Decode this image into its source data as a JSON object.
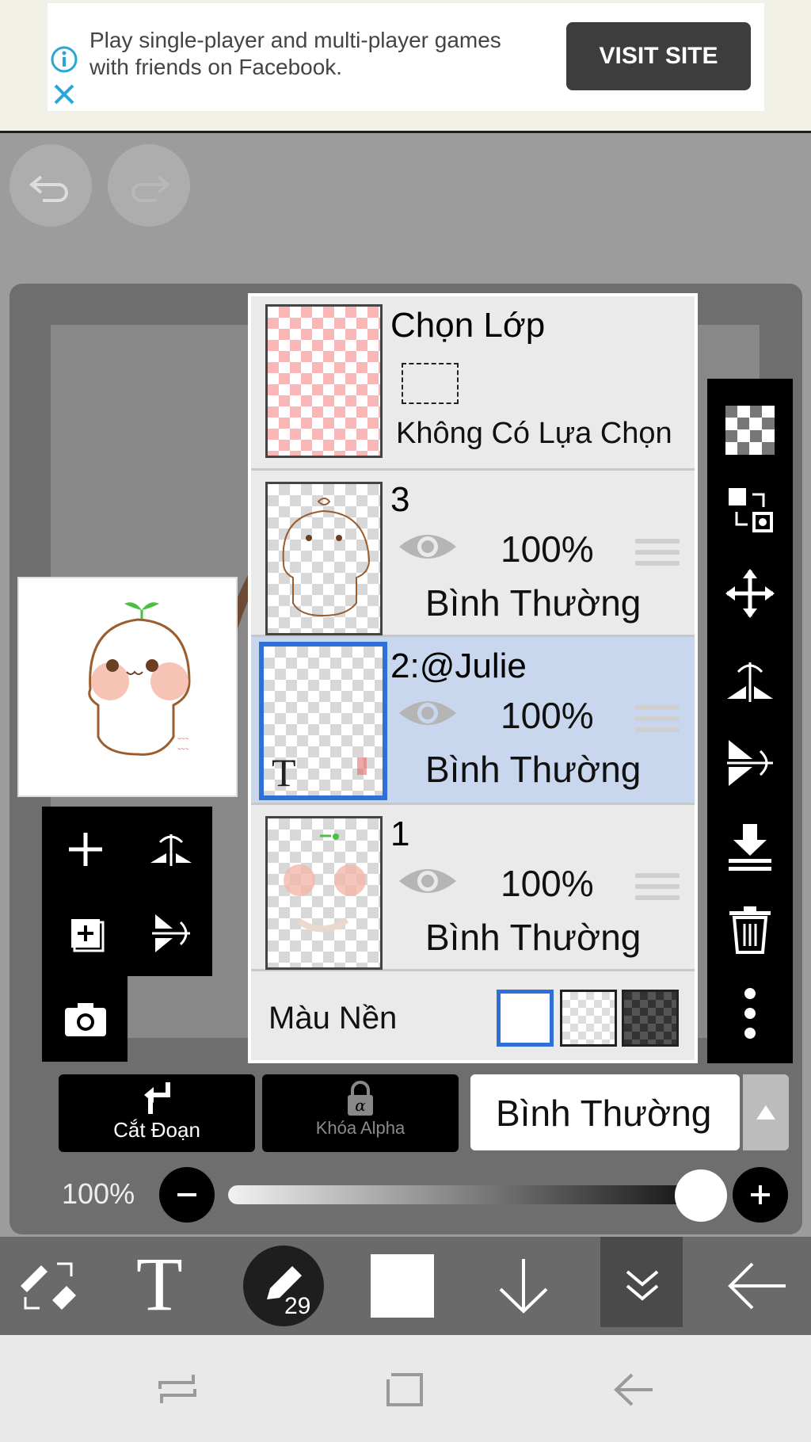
{
  "ad": {
    "text": "Play single-player and multi-player games with friends on Facebook.",
    "button": "VISIT SITE"
  },
  "history": {
    "undo_icon": "undo-icon",
    "redo_icon": "redo-icon"
  },
  "layers_panel": {
    "selection_layer": {
      "title": "Chọn Lớp",
      "subtitle": "Không Có Lựa Chọn"
    },
    "layers": [
      {
        "name": "3",
        "opacity": "100%",
        "blend": "Bình Thường",
        "selected": false
      },
      {
        "name": "2:@Julie",
        "opacity": "100%",
        "blend": "Bình Thường",
        "selected": true
      },
      {
        "name": "1",
        "opacity": "100%",
        "blend": "Bình Thường",
        "selected": false
      }
    ],
    "background_label": "Màu Nền"
  },
  "controls": {
    "clipping_label": "Cắt Đoạn",
    "alpha_lock_label": "Khóa Alpha",
    "blend_mode": "Bình Thường",
    "opacity_label": "100%",
    "opacity_value": 1.0
  },
  "toolbar": {
    "brush_size": "29"
  },
  "colors": {
    "selected_layer": "#c9d7ee",
    "selected_border": "#2f6fd8"
  }
}
